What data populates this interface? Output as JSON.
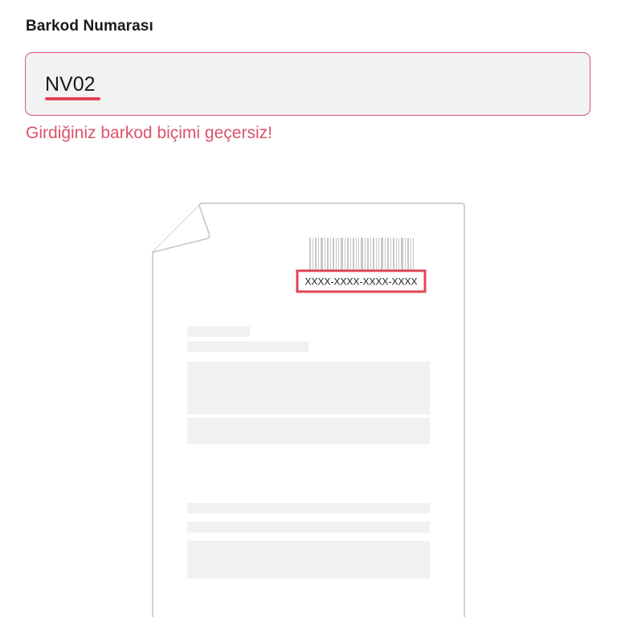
{
  "field": {
    "label": "Barkod Numarası",
    "value": "NV02",
    "error": "Girdiğiniz barkod biçimi geçersiz!"
  },
  "illustration": {
    "barcode_format": "XXXX-XXXX-XXXX-XXXX"
  },
  "colors": {
    "error": "#d9546a",
    "highlight": "#e04457",
    "input_bg": "#f3f2f2"
  }
}
